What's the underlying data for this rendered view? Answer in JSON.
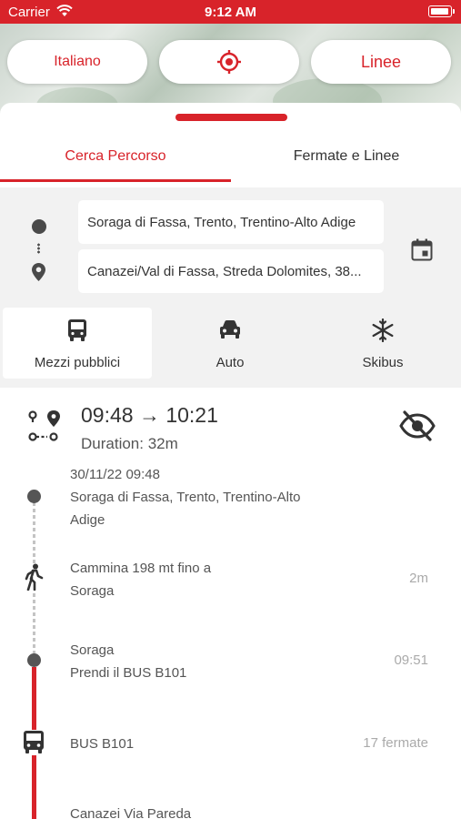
{
  "status_bar": {
    "carrier": "Carrier",
    "time": "9:12 AM"
  },
  "map_buttons": {
    "language": "Italiano",
    "lines": "Linee"
  },
  "tabs": [
    {
      "label": "Cerca Percorso",
      "active": true
    },
    {
      "label": "Fermate e Linee",
      "active": false
    }
  ],
  "search": {
    "origin": "Soraga di Fassa, Trento, Trentino-Alto Adige",
    "destination": "Canazei/Val di Fassa, Streda Dolomites, 38..."
  },
  "modes": [
    {
      "label": "Mezzi pubblici",
      "icon": "bus-icon",
      "active": true
    },
    {
      "label": "Auto",
      "icon": "car-icon",
      "active": false
    },
    {
      "label": "Skibus",
      "icon": "snowflake-icon",
      "active": false
    }
  ],
  "result": {
    "times": "09:48 → 10:21",
    "duration": "Duration: 32m",
    "steps": [
      {
        "lines": [
          "30/11/22 09:48",
          "Soraga di Fassa, Trento, Trentino-Alto",
          "Adige"
        ],
        "right": ""
      },
      {
        "lines": [
          "Cammina 198 mt fino a",
          "Soraga"
        ],
        "right": "2m"
      },
      {
        "lines": [
          "Soraga",
          "Prendi il BUS B101"
        ],
        "right": "09:51"
      },
      {
        "lines": [
          "BUS B101"
        ],
        "right": "17 fermate"
      },
      {
        "lines": [
          "Canazei Via Pareda"
        ],
        "right": ""
      }
    ]
  },
  "colors": {
    "accent": "#d8232a",
    "panel_gray": "#f2f2f2",
    "text": "#333333"
  }
}
